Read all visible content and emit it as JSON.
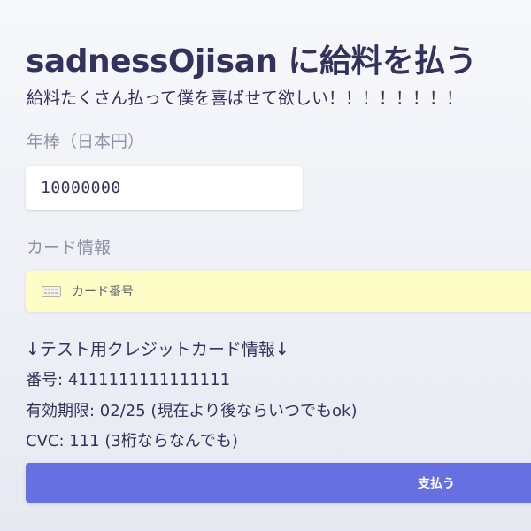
{
  "header": {
    "title": "sadnessOjisan に給料を払う",
    "subtitle": "給料たくさん払って僕を喜ばせて欲しい！！！！！！！！"
  },
  "form": {
    "salary_label": "年棒（日本円）",
    "salary_value": "10000000",
    "card_label": "カード情報",
    "card_placeholder": "カード番号",
    "card_icon": "credit-card-icon"
  },
  "test_card_info": {
    "heading": "↓テスト用クレジットカード情報↓",
    "number_line": "番号: 4111111111111111",
    "expiry_line": "有効期限: 02/25 (現在より後ならいつでもok)",
    "cvc_line": "CVC: 111 (3桁ならなんでも)"
  },
  "pay_button": {
    "label": "支払う",
    "color": "#6670e0"
  },
  "colors": {
    "text": "#32325d",
    "muted_label": "#8c92a8",
    "card_autofill_bg": "#fefdc5"
  }
}
